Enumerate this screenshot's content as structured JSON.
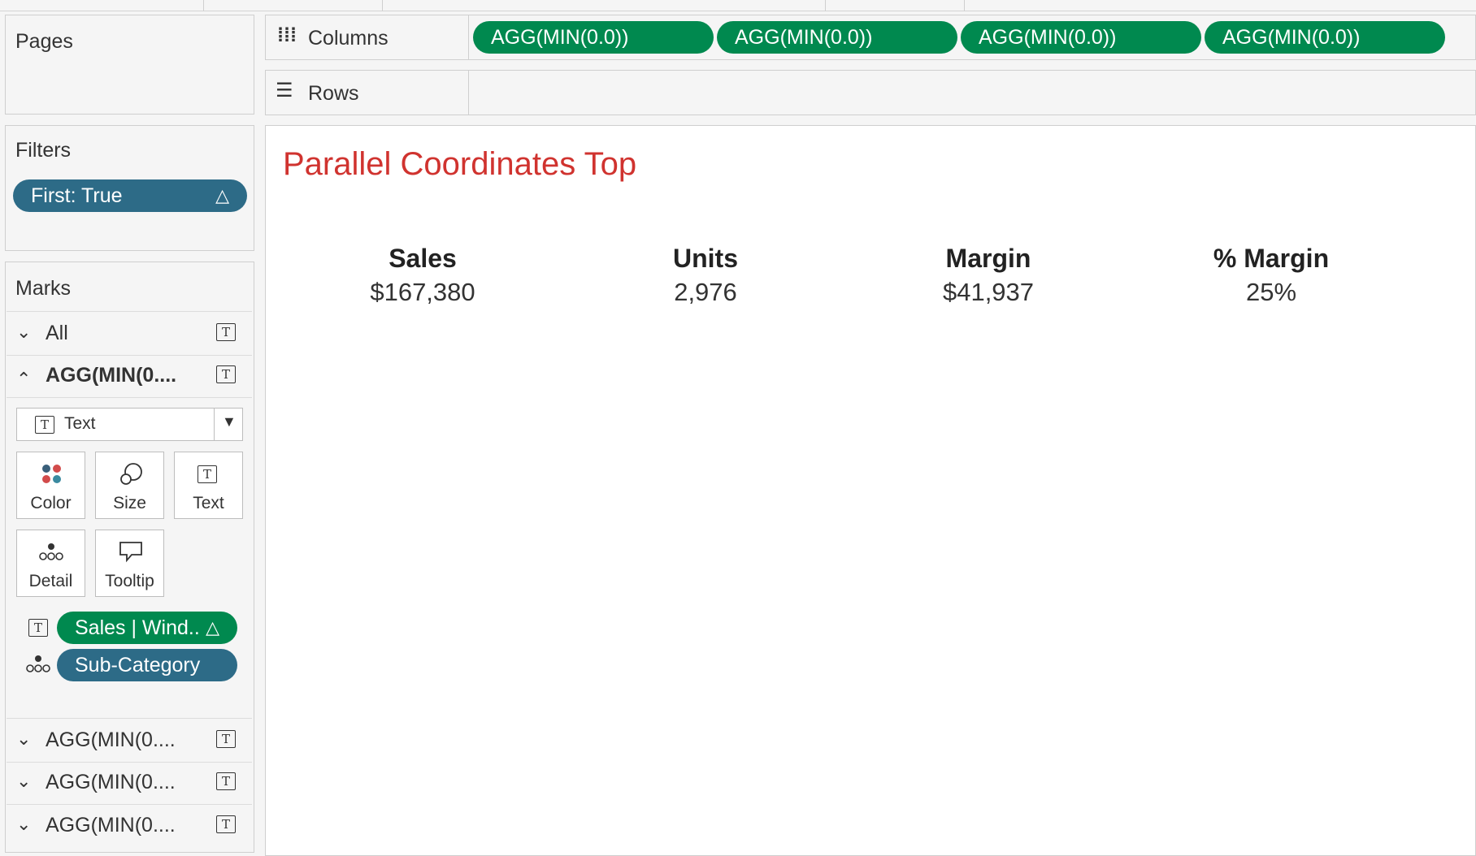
{
  "pages": {
    "title": "Pages"
  },
  "filters": {
    "title": "Filters",
    "pill": {
      "label": "First: True",
      "delta": "△"
    }
  },
  "columns": {
    "label": "Columns",
    "pills": [
      "AGG(MIN(0.0))",
      "AGG(MIN(0.0))",
      "AGG(MIN(0.0))",
      "AGG(MIN(0.0))"
    ]
  },
  "rows": {
    "label": "Rows"
  },
  "marks": {
    "title": "Marks",
    "all_label": "All",
    "active_card_label": "AGG(MIN(0....",
    "mark_type": "Text",
    "buttons": {
      "color": "Color",
      "size": "Size",
      "text": "Text",
      "detail": "Detail",
      "tooltip": "Tooltip"
    },
    "fields": [
      {
        "label": "Sales | Wind..",
        "delta": "△",
        "color": "#00894f",
        "icon": "text-icon"
      },
      {
        "label": "Sub-Category",
        "color": "#2d6b87",
        "icon": "detail-icon"
      }
    ],
    "other_cards": [
      "AGG(MIN(0....",
      "AGG(MIN(0....",
      "AGG(MIN(0...."
    ]
  },
  "view": {
    "title": "Parallel Coordinates Top",
    "title_color": "#d0332f",
    "kpis": [
      {
        "label": "Sales",
        "value": "$167,380"
      },
      {
        "label": "Units",
        "value": "2,976"
      },
      {
        "label": "Margin",
        "value": "$41,937"
      },
      {
        "label": "% Margin",
        "value": "25%"
      }
    ]
  }
}
